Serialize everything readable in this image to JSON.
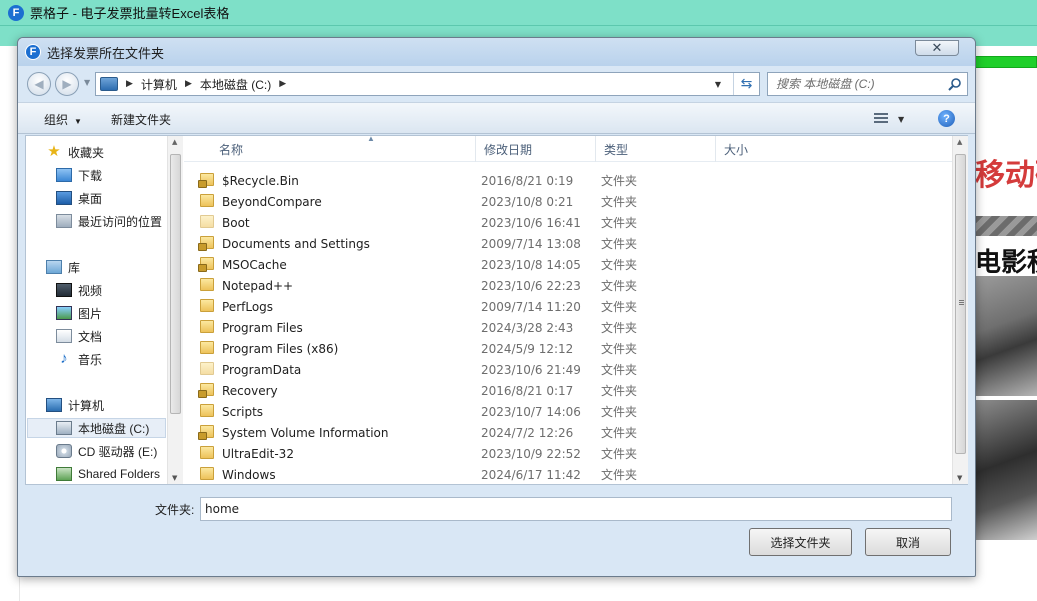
{
  "app": {
    "title": "票格子 - 电子发票批量转Excel表格",
    "icon_letter": "F",
    "ad_text_red": "移动硬",
    "ad_text_black": "电影秒"
  },
  "dialog": {
    "title": "选择发票所在文件夹",
    "icon_letter": "F",
    "close_label": "✕"
  },
  "address": {
    "crumbs": [
      "计算机",
      "本地磁盘 (C:)"
    ],
    "search_placeholder": "搜索 本地磁盘 (C:)"
  },
  "toolbar": {
    "organize": "组织",
    "new_folder": "新建文件夹",
    "help": "?"
  },
  "sidebar": {
    "items": [
      {
        "label": "收藏夹",
        "icon": "favorites-star-icon"
      },
      {
        "label": "下载",
        "icon": "downloads-folder-icon"
      },
      {
        "label": "桌面",
        "icon": "desktop-icon"
      },
      {
        "label": "最近访问的位置",
        "icon": "recent-places-icon"
      },
      {
        "label": "库",
        "icon": "libraries-icon"
      },
      {
        "label": "视频",
        "icon": "videos-icon"
      },
      {
        "label": "图片",
        "icon": "pictures-icon"
      },
      {
        "label": "文档",
        "icon": "documents-icon"
      },
      {
        "label": "音乐",
        "icon": "music-icon"
      },
      {
        "label": "计算机",
        "icon": "computer-icon"
      },
      {
        "label": "本地磁盘 (C:)",
        "icon": "local-disk-icon",
        "selected": true
      },
      {
        "label": "CD 驱动器 (E:)",
        "icon": "cd-drive-icon"
      },
      {
        "label": "Shared Folders",
        "icon": "shared-folders-icon"
      }
    ]
  },
  "columns": {
    "name": "名称",
    "date": "修改日期",
    "type": "类型",
    "size": "大小"
  },
  "files": [
    {
      "name": "$Recycle.Bin",
      "date": "2016/8/21 0:19",
      "type": "文件夹",
      "icon": "locked-folder-icon"
    },
    {
      "name": "BeyondCompare",
      "date": "2023/10/8 0:21",
      "type": "文件夹",
      "icon": "folder-icon"
    },
    {
      "name": "Boot",
      "date": "2023/10/6 16:41",
      "type": "文件夹",
      "icon": "hidden-folder-icon"
    },
    {
      "name": "Documents and Settings",
      "date": "2009/7/14 13:08",
      "type": "文件夹",
      "icon": "locked-folder-icon"
    },
    {
      "name": "MSOCache",
      "date": "2023/10/8 14:05",
      "type": "文件夹",
      "icon": "locked-folder-icon"
    },
    {
      "name": "Notepad++",
      "date": "2023/10/6 22:23",
      "type": "文件夹",
      "icon": "folder-icon"
    },
    {
      "name": "PerfLogs",
      "date": "2009/7/14 11:20",
      "type": "文件夹",
      "icon": "folder-icon"
    },
    {
      "name": "Program Files",
      "date": "2024/3/28 2:43",
      "type": "文件夹",
      "icon": "folder-icon"
    },
    {
      "name": "Program Files (x86)",
      "date": "2024/5/9 12:12",
      "type": "文件夹",
      "icon": "folder-icon"
    },
    {
      "name": "ProgramData",
      "date": "2023/10/6 21:49",
      "type": "文件夹",
      "icon": "hidden-folder-icon"
    },
    {
      "name": "Recovery",
      "date": "2016/8/21 0:17",
      "type": "文件夹",
      "icon": "locked-folder-icon"
    },
    {
      "name": "Scripts",
      "date": "2023/10/7 14:06",
      "type": "文件夹",
      "icon": "folder-icon"
    },
    {
      "name": "System Volume Information",
      "date": "2024/7/2 12:26",
      "type": "文件夹",
      "icon": "locked-folder-icon"
    },
    {
      "name": "UltraEdit-32",
      "date": "2023/10/9 22:52",
      "type": "文件夹",
      "icon": "folder-icon"
    },
    {
      "name": "Windows",
      "date": "2024/6/17 11:42",
      "type": "文件夹",
      "icon": "folder-icon"
    }
  ],
  "bottom": {
    "folder_label": "文件夹:",
    "folder_value": "home",
    "select_button": "选择文件夹",
    "cancel_button": "取消"
  }
}
